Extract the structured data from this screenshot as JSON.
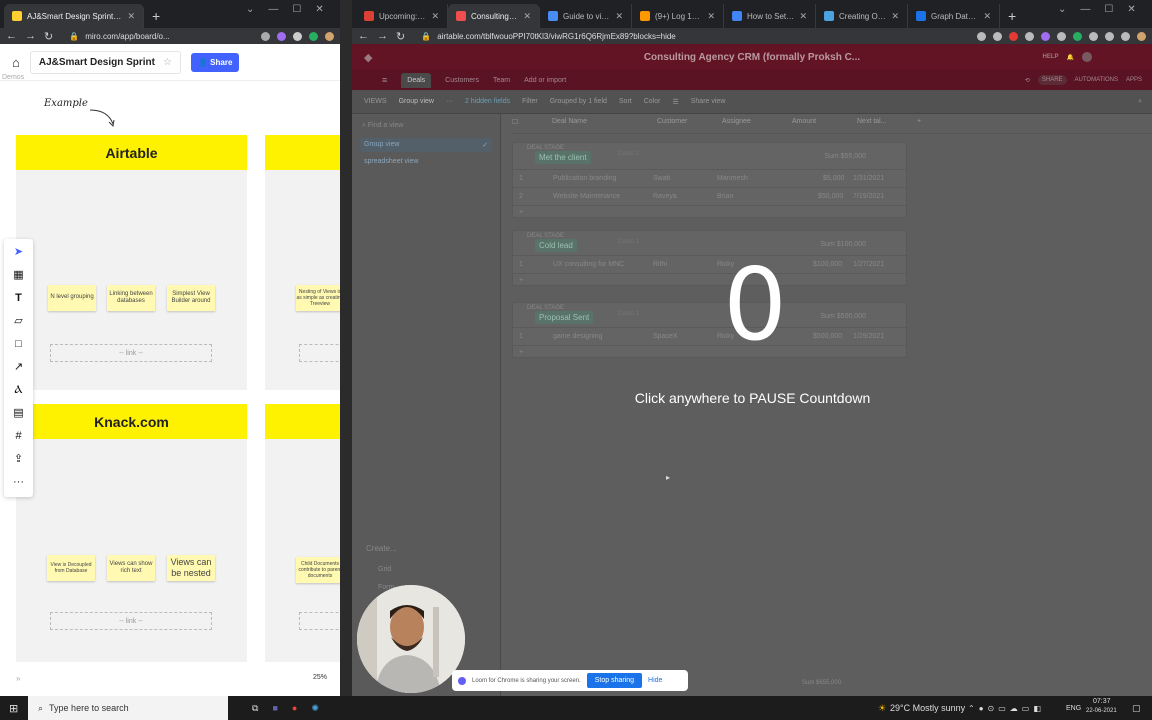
{
  "left_window": {
    "tabs": [
      {
        "title": "AJ&Smart Design Sprint, Online"
      }
    ],
    "url": "miro.com/app/board/o...",
    "board_name": "AJ&Smart Design Sprint",
    "share_label": "Share",
    "cut_label": "Demos",
    "example_label": "Example",
    "frames": [
      {
        "title": "Airtable",
        "stickies": [
          "N level grouping",
          "Linking between databases",
          "Simplest View Builder around"
        ],
        "link": "-- link --"
      },
      {
        "title": "Knack.com",
        "stickies": [
          "View is Decoupled from Database",
          "Views can show rich text",
          "Views can be nested"
        ],
        "link": "-- link --"
      }
    ],
    "partial_stickies": [
      "Nesting of Views is as simple as creating Treeview",
      "Child Documents contribute to parent documents"
    ],
    "zoom": "25%",
    "tools": [
      "select-tool-icon",
      "template-icon",
      "text-tool-icon",
      "sticky-note-icon",
      "shape-icon",
      "line-icon",
      "pen-icon",
      "comment-icon",
      "frame-icon",
      "upload-icon",
      "more-icon"
    ]
  },
  "right_window": {
    "tabs": [
      {
        "title": "Upcoming: Todoist",
        "color": "#db4035"
      },
      {
        "title": "Consulting Ag",
        "color": "#f04e4e",
        "active": true
      },
      {
        "title": "Guide to views · A",
        "color": "#4a8cf6"
      },
      {
        "title": "(9+) Log 1300hr/n",
        "color": "#ff9800"
      },
      {
        "title": "How to Set Goals",
        "color": "#4285f4"
      },
      {
        "title": "Creating Objective",
        "color": "#4aa3df"
      },
      {
        "title": "Graph Database Vi",
        "color": "#1a73e8"
      }
    ],
    "url": "airtable.com/tblfwouoPPI70tKl3/viwRG1r6Q6RjmEx89?blocks=hide",
    "base_title": "Consulting Agency CRM (formally Proksh C...",
    "help": "HELP",
    "share": "SHARE",
    "automations": "AUTOMATIONS",
    "apps": "APPS",
    "nav": [
      "Deals",
      "Customers",
      "Team",
      "Add or import"
    ],
    "view_bar": [
      "VIEWS",
      "Group view",
      "2 hidden fields",
      "Filter",
      "Grouped by 1 field",
      "Sort",
      "Color",
      "Share view"
    ],
    "find_view": "Find a view",
    "views": [
      "Group view",
      "spreadsheet view"
    ],
    "create": "Create...",
    "create_items": [
      "Grid",
      "Form"
    ],
    "columns": [
      "Deal Name",
      "Customer",
      "Assignee",
      "Amount",
      "Next tal..."
    ],
    "groups": [
      {
        "label": "DEAL STAGE",
        "name": "Met the client",
        "count": "Count 2",
        "sum": "Sum $55,000",
        "rows": [
          {
            "n": "1",
            "deal": "Publication branding",
            "customer": "Swati",
            "assignee": "Manmesh",
            "amount": "$5,000",
            "date": "1/31/2021"
          },
          {
            "n": "2",
            "deal": "Website Maintenance",
            "customer": "Raveya",
            "assignee": "Brian",
            "amount": "$50,000",
            "date": "7/19/2021"
          }
        ]
      },
      {
        "label": "DEAL STAGE",
        "name": "Cold lead",
        "count": "Count 1",
        "sum": "Sum $100,000",
        "rows": [
          {
            "n": "1",
            "deal": "UX consulting for MNC",
            "customer": "Rithi",
            "assignee": "Ricky",
            "amount": "$100,000",
            "date": "1/27/2021"
          }
        ]
      },
      {
        "label": "DEAL STAGE",
        "name": "Proposal Sent",
        "count": "Count 1",
        "sum": "Sum $500,000",
        "rows": [
          {
            "n": "1",
            "deal": "game designing",
            "customer": "SpaceX",
            "assignee": "Ricky",
            "amount": "$500,000",
            "date": "1/29/2021"
          }
        ]
      }
    ],
    "total_sum": "Sum $655,000",
    "countdown": "0",
    "countdown_msg": "Click anywhere to PAUSE Countdown"
  },
  "loom_bar": {
    "text": "Loom for Chrome is sharing your screen.",
    "stop": "Stop sharing",
    "hide": "Hide"
  },
  "taskbar": {
    "search": "Type here to search",
    "weather": "29°C  Mostly sunny",
    "lang": "ENG",
    "time": "07:37",
    "date": "22-06-2021"
  }
}
